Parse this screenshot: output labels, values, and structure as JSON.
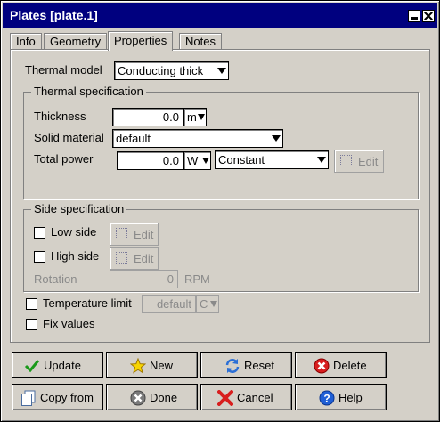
{
  "window": {
    "title": "Plates [plate.1]"
  },
  "tabs": [
    "Info",
    "Geometry",
    "Properties",
    "Notes"
  ],
  "thermal_model": {
    "label": "Thermal model",
    "value": "Conducting thick"
  },
  "thermal_spec": {
    "title": "Thermal specification",
    "thickness_label": "Thickness",
    "thickness_value": "0.0",
    "thickness_unit": "m",
    "solid_material_label": "Solid material",
    "solid_material_value": "default",
    "total_power_label": "Total power",
    "total_power_value": "0.0",
    "total_power_unit": "W",
    "power_mode": "Constant",
    "edit_label": "Edit"
  },
  "side_spec": {
    "title": "Side specification",
    "low_side_label": "Low side",
    "high_side_label": "High side",
    "edit_label": "Edit",
    "rotation_label": "Rotation",
    "rotation_value": "0",
    "rotation_unit": "RPM"
  },
  "temperature_limit": {
    "label": "Temperature limit",
    "value": "default",
    "unit": "C"
  },
  "fix_values": {
    "label": "Fix values"
  },
  "buttons": {
    "update": "Update",
    "new": "New",
    "reset": "Reset",
    "delete": "Delete",
    "copy_from": "Copy from",
    "done": "Done",
    "cancel": "Cancel",
    "help": "Help"
  },
  "colors": {
    "titlebar": "#00007f",
    "dialog": "#d4d0c8"
  }
}
